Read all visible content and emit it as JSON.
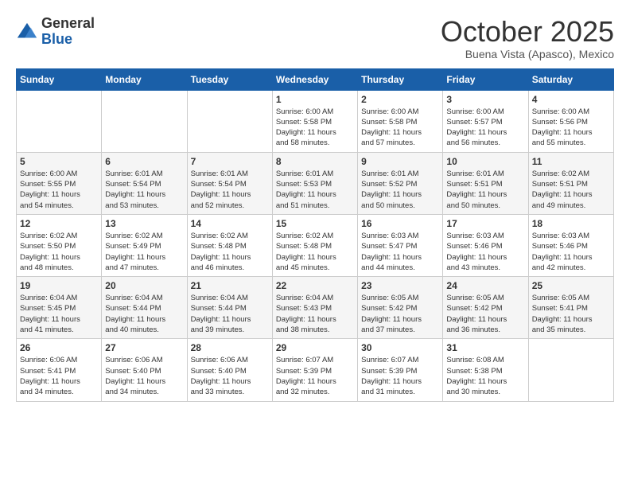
{
  "logo": {
    "general": "General",
    "blue": "Blue"
  },
  "title": "October 2025",
  "location": "Buena Vista (Apasco), Mexico",
  "weekdays": [
    "Sunday",
    "Monday",
    "Tuesday",
    "Wednesday",
    "Thursday",
    "Friday",
    "Saturday"
  ],
  "weeks": [
    [
      {
        "day": "",
        "info": ""
      },
      {
        "day": "",
        "info": ""
      },
      {
        "day": "",
        "info": ""
      },
      {
        "day": "1",
        "info": "Sunrise: 6:00 AM\nSunset: 5:58 PM\nDaylight: 11 hours\nand 58 minutes."
      },
      {
        "day": "2",
        "info": "Sunrise: 6:00 AM\nSunset: 5:58 PM\nDaylight: 11 hours\nand 57 minutes."
      },
      {
        "day": "3",
        "info": "Sunrise: 6:00 AM\nSunset: 5:57 PM\nDaylight: 11 hours\nand 56 minutes."
      },
      {
        "day": "4",
        "info": "Sunrise: 6:00 AM\nSunset: 5:56 PM\nDaylight: 11 hours\nand 55 minutes."
      }
    ],
    [
      {
        "day": "5",
        "info": "Sunrise: 6:00 AM\nSunset: 5:55 PM\nDaylight: 11 hours\nand 54 minutes."
      },
      {
        "day": "6",
        "info": "Sunrise: 6:01 AM\nSunset: 5:54 PM\nDaylight: 11 hours\nand 53 minutes."
      },
      {
        "day": "7",
        "info": "Sunrise: 6:01 AM\nSunset: 5:54 PM\nDaylight: 11 hours\nand 52 minutes."
      },
      {
        "day": "8",
        "info": "Sunrise: 6:01 AM\nSunset: 5:53 PM\nDaylight: 11 hours\nand 51 minutes."
      },
      {
        "day": "9",
        "info": "Sunrise: 6:01 AM\nSunset: 5:52 PM\nDaylight: 11 hours\nand 50 minutes."
      },
      {
        "day": "10",
        "info": "Sunrise: 6:01 AM\nSunset: 5:51 PM\nDaylight: 11 hours\nand 50 minutes."
      },
      {
        "day": "11",
        "info": "Sunrise: 6:02 AM\nSunset: 5:51 PM\nDaylight: 11 hours\nand 49 minutes."
      }
    ],
    [
      {
        "day": "12",
        "info": "Sunrise: 6:02 AM\nSunset: 5:50 PM\nDaylight: 11 hours\nand 48 minutes."
      },
      {
        "day": "13",
        "info": "Sunrise: 6:02 AM\nSunset: 5:49 PM\nDaylight: 11 hours\nand 47 minutes."
      },
      {
        "day": "14",
        "info": "Sunrise: 6:02 AM\nSunset: 5:48 PM\nDaylight: 11 hours\nand 46 minutes."
      },
      {
        "day": "15",
        "info": "Sunrise: 6:02 AM\nSunset: 5:48 PM\nDaylight: 11 hours\nand 45 minutes."
      },
      {
        "day": "16",
        "info": "Sunrise: 6:03 AM\nSunset: 5:47 PM\nDaylight: 11 hours\nand 44 minutes."
      },
      {
        "day": "17",
        "info": "Sunrise: 6:03 AM\nSunset: 5:46 PM\nDaylight: 11 hours\nand 43 minutes."
      },
      {
        "day": "18",
        "info": "Sunrise: 6:03 AM\nSunset: 5:46 PM\nDaylight: 11 hours\nand 42 minutes."
      }
    ],
    [
      {
        "day": "19",
        "info": "Sunrise: 6:04 AM\nSunset: 5:45 PM\nDaylight: 11 hours\nand 41 minutes."
      },
      {
        "day": "20",
        "info": "Sunrise: 6:04 AM\nSunset: 5:44 PM\nDaylight: 11 hours\nand 40 minutes."
      },
      {
        "day": "21",
        "info": "Sunrise: 6:04 AM\nSunset: 5:44 PM\nDaylight: 11 hours\nand 39 minutes."
      },
      {
        "day": "22",
        "info": "Sunrise: 6:04 AM\nSunset: 5:43 PM\nDaylight: 11 hours\nand 38 minutes."
      },
      {
        "day": "23",
        "info": "Sunrise: 6:05 AM\nSunset: 5:42 PM\nDaylight: 11 hours\nand 37 minutes."
      },
      {
        "day": "24",
        "info": "Sunrise: 6:05 AM\nSunset: 5:42 PM\nDaylight: 11 hours\nand 36 minutes."
      },
      {
        "day": "25",
        "info": "Sunrise: 6:05 AM\nSunset: 5:41 PM\nDaylight: 11 hours\nand 35 minutes."
      }
    ],
    [
      {
        "day": "26",
        "info": "Sunrise: 6:06 AM\nSunset: 5:41 PM\nDaylight: 11 hours\nand 34 minutes."
      },
      {
        "day": "27",
        "info": "Sunrise: 6:06 AM\nSunset: 5:40 PM\nDaylight: 11 hours\nand 34 minutes."
      },
      {
        "day": "28",
        "info": "Sunrise: 6:06 AM\nSunset: 5:40 PM\nDaylight: 11 hours\nand 33 minutes."
      },
      {
        "day": "29",
        "info": "Sunrise: 6:07 AM\nSunset: 5:39 PM\nDaylight: 11 hours\nand 32 minutes."
      },
      {
        "day": "30",
        "info": "Sunrise: 6:07 AM\nSunset: 5:39 PM\nDaylight: 11 hours\nand 31 minutes."
      },
      {
        "day": "31",
        "info": "Sunrise: 6:08 AM\nSunset: 5:38 PM\nDaylight: 11 hours\nand 30 minutes."
      },
      {
        "day": "",
        "info": ""
      }
    ]
  ]
}
